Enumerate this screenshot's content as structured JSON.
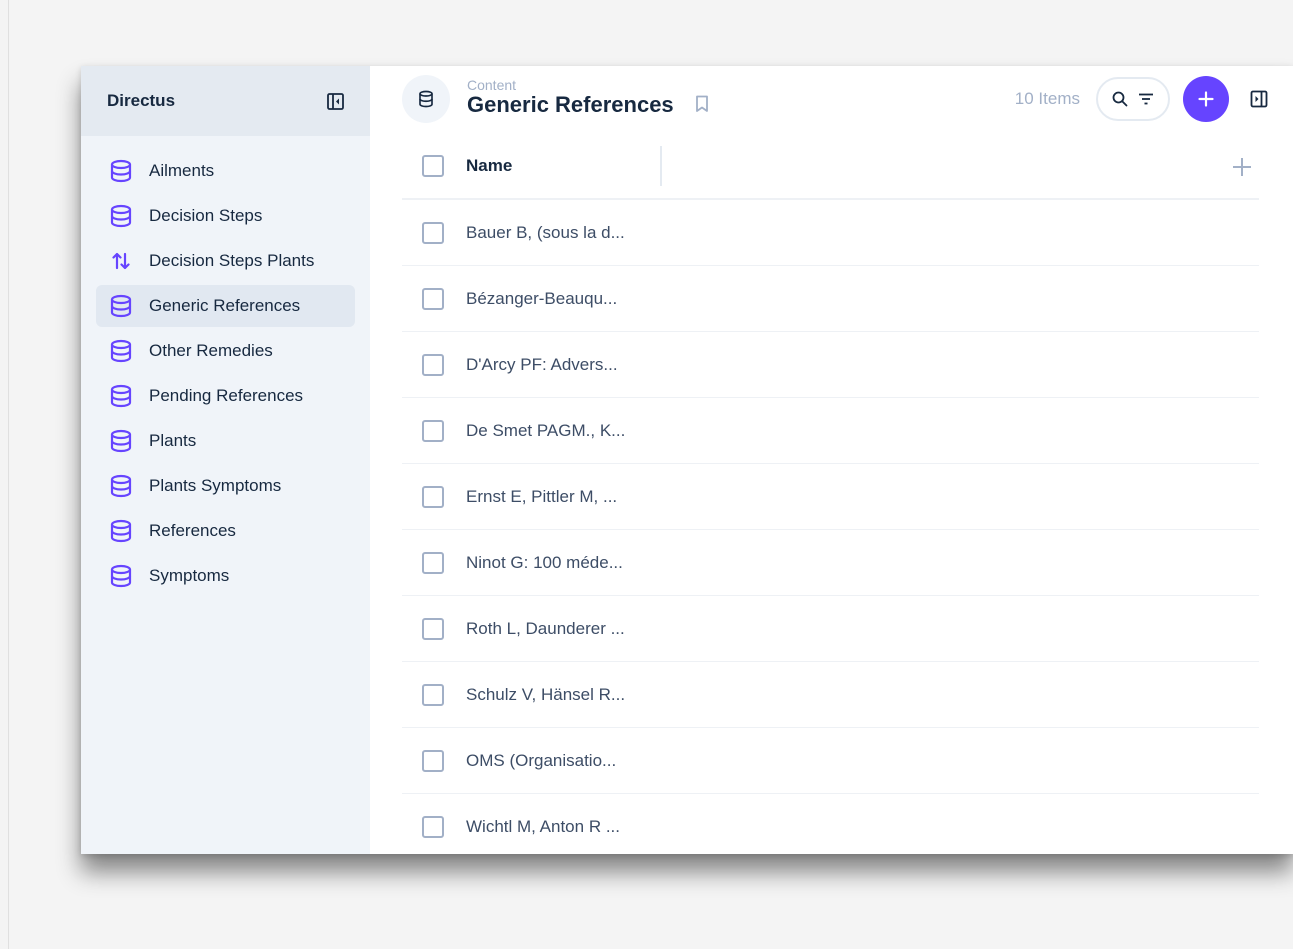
{
  "app": {
    "name": "Directus"
  },
  "sidebar": {
    "items": [
      {
        "label": "Ailments",
        "icon": "database-icon",
        "active": false
      },
      {
        "label": "Decision Steps",
        "icon": "database-icon",
        "active": false
      },
      {
        "label": "Decision Steps Plants",
        "icon": "swap-vertical-icon",
        "active": false
      },
      {
        "label": "Generic References",
        "icon": "database-icon",
        "active": true
      },
      {
        "label": "Other Remedies",
        "icon": "database-icon",
        "active": false
      },
      {
        "label": "Pending References",
        "icon": "database-icon",
        "active": false
      },
      {
        "label": "Plants",
        "icon": "database-icon",
        "active": false
      },
      {
        "label": "Plants Symptoms",
        "icon": "database-icon",
        "active": false
      },
      {
        "label": "References",
        "icon": "database-icon",
        "active": false
      },
      {
        "label": "Symptoms",
        "icon": "database-icon",
        "active": false
      }
    ]
  },
  "header": {
    "breadcrumb": "Content",
    "title": "Generic References",
    "item_count": "10 Items"
  },
  "table": {
    "columns": [
      "Name"
    ],
    "rows": [
      "Bauer B, (sous la d...",
      "Bézanger-Beauqu...",
      "D'Arcy PF: Advers...",
      "De Smet PAGM., K...",
      "Ernst E, Pittler M, ...",
      "Ninot G: 100 méde...",
      "Roth L, Daunderer ...",
      "Schulz V, Hänsel R...",
      "OMS (Organisatio...",
      "Wichtl M, Anton R ..."
    ]
  },
  "colors": {
    "accent": "#6644ff",
    "sidebar_bg": "#f0f4f9",
    "sidebar_header_bg": "#e4eaf1",
    "text_primary": "#172940",
    "text_muted": "#a2b0c7"
  }
}
